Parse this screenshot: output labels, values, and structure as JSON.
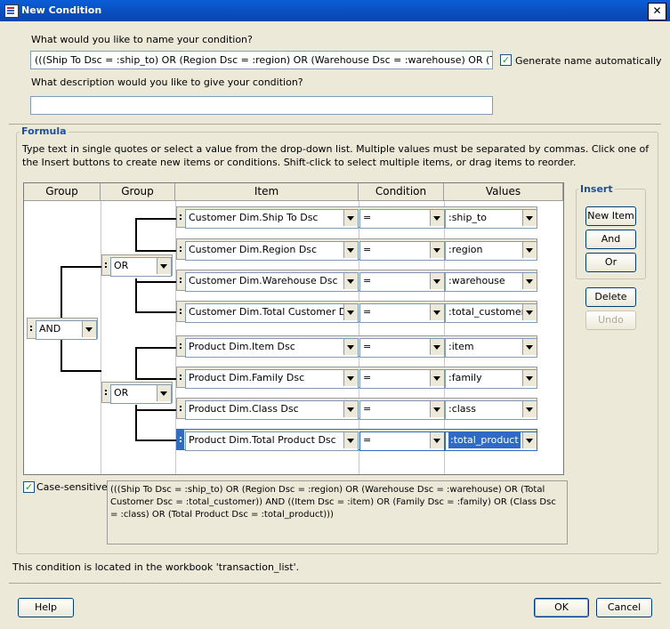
{
  "window": {
    "title": "New Condition",
    "close_glyph": "✕"
  },
  "name_section": {
    "prompt": "What would you like to name your condition?",
    "value": "(((Ship To Dsc = :ship_to) OR (Region Dsc = :region) OR (Warehouse Dsc = :warehouse) OR (Total Custo",
    "auto_label": "Generate name automatically",
    "auto_checked": true
  },
  "description_section": {
    "prompt": "What description would you like to give your condition?",
    "value": ""
  },
  "formula": {
    "title": "Formula",
    "help": "Type text in single quotes or select a value from the drop-down list. Multiple values must be separated by commas. Click one of the Insert buttons to create new items or conditions. Shift-click to select multiple items, or drag items to reorder.",
    "columns": [
      "Group",
      "Group",
      "Item",
      "Condition",
      "Values"
    ],
    "groups": {
      "outer": "AND",
      "inner1": "OR",
      "inner2": "OR",
      "handle": ":"
    },
    "rows": [
      {
        "item": "Customer Dim.Ship To Dsc",
        "condition": "=",
        "value": ":ship_to"
      },
      {
        "item": "Customer Dim.Region Dsc",
        "condition": "=",
        "value": ":region"
      },
      {
        "item": "Customer Dim.Warehouse Dsc",
        "condition": "=",
        "value": ":warehouse"
      },
      {
        "item": "Customer Dim.Total Customer Dsc",
        "condition": "=",
        "value": ":total_customer"
      },
      {
        "item": "Product Dim.Item Dsc",
        "condition": "=",
        "value": ":item"
      },
      {
        "item": "Product Dim.Family Dsc",
        "condition": "=",
        "value": ":family"
      },
      {
        "item": "Product Dim.Class Dsc",
        "condition": "=",
        "value": ":class"
      },
      {
        "item": "Product Dim.Total Product Dsc",
        "condition": "=",
        "value": ":total_product"
      }
    ],
    "insert": {
      "title": "Insert",
      "new_item": "New Item",
      "and": "And",
      "or": "Or"
    },
    "delete": "Delete",
    "undo": "Undo",
    "case_sensitive": {
      "label": "Case-sensitive",
      "checked": true
    },
    "summary": "(((Ship To Dsc = :ship_to) OR (Region Dsc = :region) OR (Warehouse Dsc = :warehouse) OR (Total Customer Dsc = :total_customer)) AND ((Item Dsc = :item) OR (Family Dsc = :family) OR (Class Dsc = :class) OR (Total Product Dsc = :total_product)))"
  },
  "location_text": "This condition is located in the workbook 'transaction_list'.",
  "buttons": {
    "help": "Help",
    "ok": "OK",
    "cancel": "Cancel"
  },
  "colors": {
    "accent": "#316ac5",
    "title_bar": "#0a5ed8",
    "group_title": "#1f4f9f"
  },
  "icons": {
    "window": "condition-icon",
    "close": "close-icon",
    "check": "checkmark-icon",
    "dropdown": "chevron-down-icon"
  }
}
